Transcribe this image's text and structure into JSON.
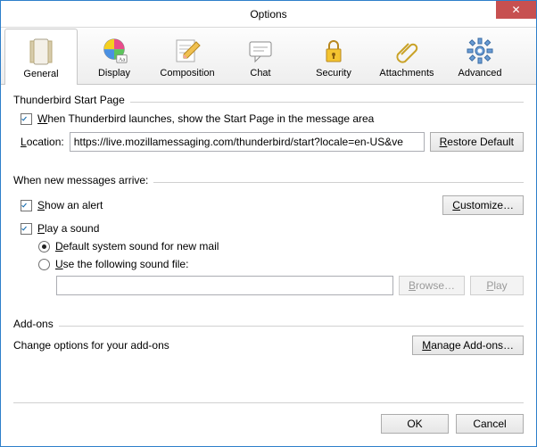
{
  "window": {
    "title": "Options",
    "close": "✕"
  },
  "tabs": [
    {
      "label": "General"
    },
    {
      "label": "Display"
    },
    {
      "label": "Composition"
    },
    {
      "label": "Chat"
    },
    {
      "label": "Security"
    },
    {
      "label": "Attachments"
    },
    {
      "label": "Advanced"
    }
  ],
  "startpage": {
    "group_title": "Thunderbird Start Page",
    "checkbox_label_pre": "W",
    "checkbox_label_rest": "hen Thunderbird launches, show the Start Page in the message area",
    "location_label_pre": "L",
    "location_label_rest": "ocation:",
    "location_value": "https://live.mozillamessaging.com/thunderbird/start?locale=en-US&ve",
    "restore_pre": "R",
    "restore_rest": "estore Default"
  },
  "newmsg": {
    "group_title": "When new messages arrive:",
    "alert_pre": "S",
    "alert_rest": "how an alert",
    "customize_pre": "C",
    "customize_rest": "ustomize…",
    "play_pre": "P",
    "play_rest": "lay a sound",
    "radio_default_pre": "D",
    "radio_default_rest": "efault system sound for new mail",
    "radio_file_pre": "U",
    "radio_file_rest": "se the following sound file:",
    "sound_file_value": "",
    "browse_pre": "B",
    "browse_rest": "rowse…",
    "play_btn_pre": "P",
    "play_btn_rest": "lay"
  },
  "addons": {
    "group_title": "Add-ons",
    "desc": "Change options for your add-ons",
    "manage_pre": "M",
    "manage_rest": "anage Add-ons…"
  },
  "footer": {
    "ok": "OK",
    "cancel": "Cancel"
  }
}
